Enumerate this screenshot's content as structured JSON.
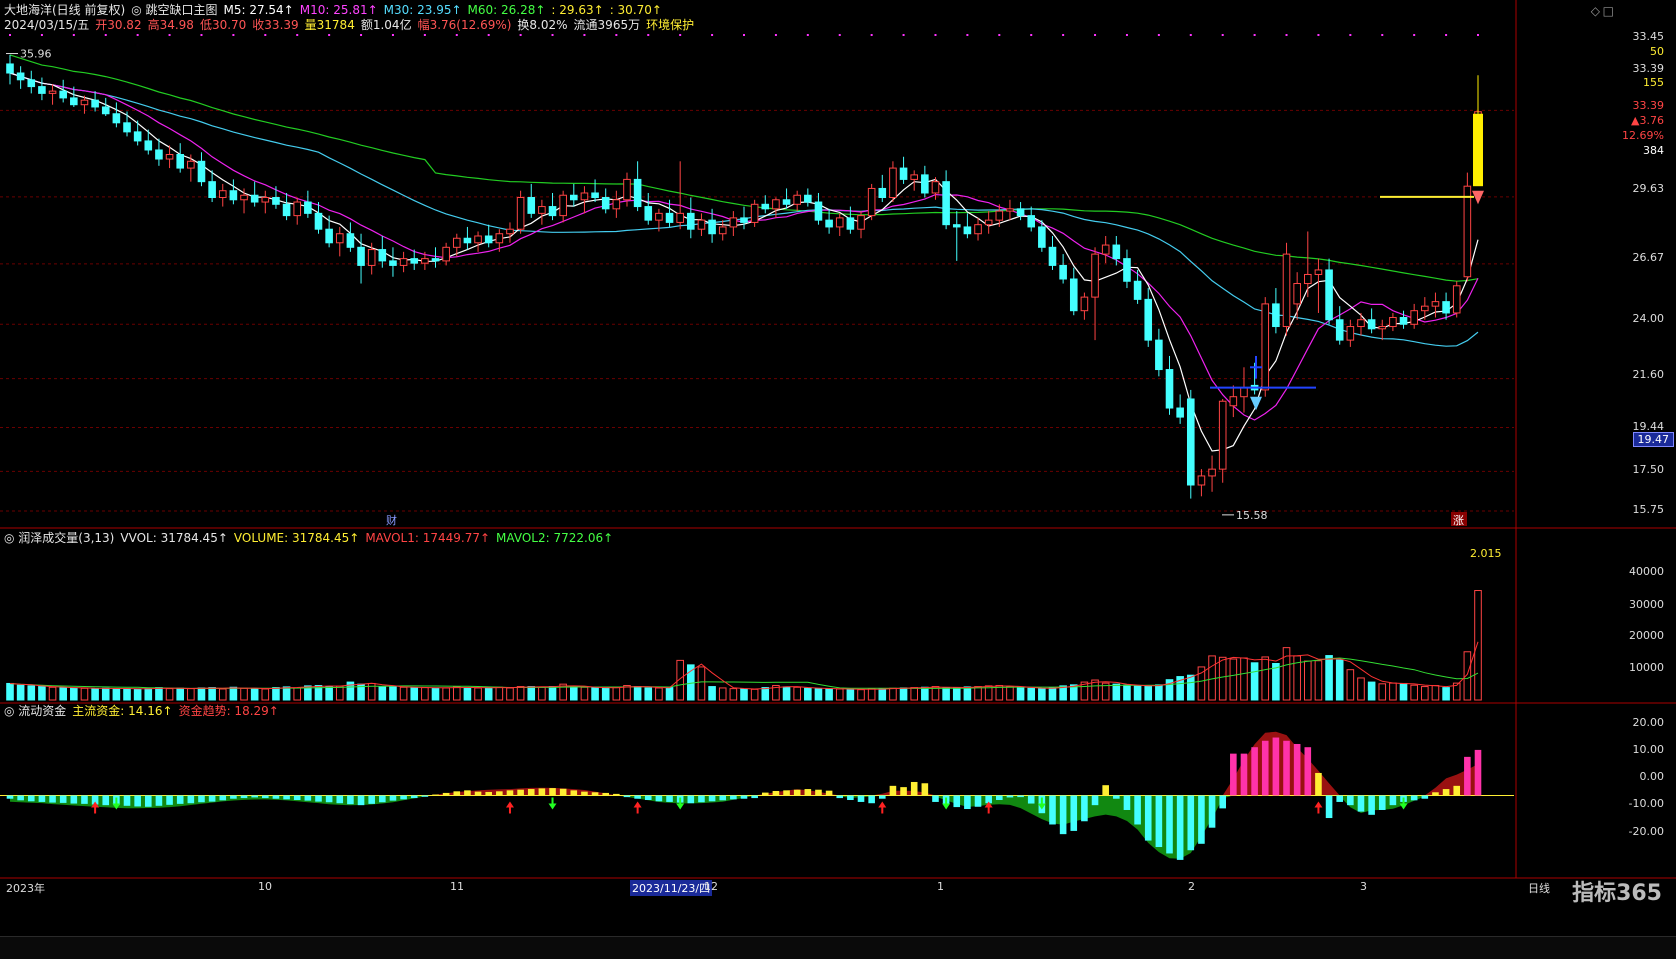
{
  "main": {
    "info1": [
      {
        "text": "大地海洋(日线 前复权)",
        "color": "#e6e6e6"
      },
      {
        "text": "◎ 跳空缺口主图",
        "color": "#e6e6e6"
      },
      {
        "text": "M5: 27.54↑",
        "color": "#ffffff"
      },
      {
        "text": "M10: 25.81↑",
        "color": "#ff44ff"
      },
      {
        "text": "M30: 23.95↑",
        "color": "#55ddff"
      },
      {
        "text": "M60: 26.28↑",
        "color": "#44ff44"
      },
      {
        "text": ": 29.63↑",
        "color": "#ffee33"
      },
      {
        "text": ": 30.70↑",
        "color": "#ffee33"
      }
    ],
    "info2": [
      {
        "text": "2024/03/15/五",
        "color": "#e6e6e6"
      },
      {
        "text": "开30.82",
        "color": "#ff5555"
      },
      {
        "text": "高34.98",
        "color": "#ff5555"
      },
      {
        "text": "低30.70",
        "color": "#ff5555"
      },
      {
        "text": "收33.39",
        "color": "#ff5555"
      },
      {
        "text": "量31784",
        "color": "#ffee33"
      },
      {
        "text": "额1.04亿",
        "color": "#e6e6e6"
      },
      {
        "text": "幅3.76(12.69%)",
        "color": "#ff5555"
      },
      {
        "text": "换8.02%",
        "color": "#e6e6e6"
      },
      {
        "text": "流通3965万",
        "color": "#e6e6e6"
      },
      {
        "text": "环境保护",
        "color": "#ffee33"
      }
    ],
    "price_axis": [
      "33.45",
      "50",
      "33.39",
      "155",
      "33.39",
      "▲3.76",
      "12.69%",
      "384",
      "29.63",
      "26.67",
      "24.00",
      "21.60",
      "19.44",
      "17.50",
      "15.75"
    ],
    "current_price": "19.47",
    "high_label": "35.96",
    "low_label": "15.58",
    "cai_marker": "财",
    "zhang_marker": "涨"
  },
  "volume": {
    "title": [
      {
        "text": "◎ 润泽成交量(3,13)",
        "color": "#e6e6e6"
      },
      {
        "text": "VVOL: 31784.45↑",
        "color": "#e6e6e6"
      },
      {
        "text": "VOLUME: 31784.45↑",
        "color": "#ffee33"
      },
      {
        "text": "MAVOL1: 17449.77↑",
        "color": "#ff4444"
      },
      {
        "text": "MAVOL2: 7722.06↑",
        "color": "#44ff44"
      }
    ],
    "axis": [
      "40000",
      "30000",
      "20000",
      "10000"
    ],
    "ratio": "2.015"
  },
  "fund": {
    "title": [
      {
        "text": "◎ 流动资金",
        "color": "#e6e6e6"
      },
      {
        "text": "主流资金: 14.16↑",
        "color": "#ffee33"
      },
      {
        "text": "资金趋势: 18.29↑",
        "color": "#ff4444"
      }
    ],
    "axis": [
      "20.00",
      "10.00",
      "0.00",
      "-10.00",
      "-20.00"
    ]
  },
  "x_axis": {
    "labels": [
      "2023年",
      "10",
      "11",
      "2023/11/23/四",
      "12",
      "1",
      "2",
      "3"
    ],
    "period": "日线"
  },
  "watermark": "指标365",
  "chart_data": [
    {
      "type": "candlestick",
      "title": "大地海洋(日线 前复权)",
      "last": {
        "date": "2024/03/15",
        "open": 30.82,
        "high": 34.98,
        "low": 30.7,
        "close": 33.39
      },
      "price_range": [
        15.0,
        37.0
      ],
      "ma": {
        "M5": 27.54,
        "M10": 25.81,
        "M30": 23.95,
        "M60": 26.28
      },
      "gap_lines": [
        29.63,
        30.7
      ],
      "high": 35.96,
      "low": 15.58,
      "candles": [
        [
          35.5,
          35.9,
          34.6,
          35.1
        ],
        [
          35.1,
          35.4,
          34.4,
          34.8
        ],
        [
          34.8,
          35.2,
          34.2,
          34.5
        ],
        [
          34.5,
          34.9,
          33.9,
          34.2
        ],
        [
          34.2,
          34.6,
          33.7,
          34.3
        ],
        [
          34.3,
          34.8,
          33.8,
          34.0
        ],
        [
          34.0,
          34.5,
          33.6,
          33.7
        ],
        [
          33.7,
          34.1,
          33.3,
          33.9
        ],
        [
          33.9,
          34.3,
          33.4,
          33.6
        ],
        [
          33.6,
          34.0,
          33.2,
          33.3
        ],
        [
          33.3,
          33.8,
          32.7,
          32.9
        ],
        [
          32.9,
          33.4,
          32.3,
          32.5
        ],
        [
          32.5,
          33.0,
          31.9,
          32.1
        ],
        [
          32.1,
          32.6,
          31.5,
          31.7
        ],
        [
          31.7,
          32.2,
          31.0,
          31.3
        ],
        [
          31.3,
          31.9,
          30.9,
          31.5
        ],
        [
          31.5,
          32.0,
          30.7,
          30.9
        ],
        [
          30.9,
          31.5,
          30.3,
          31.2
        ],
        [
          31.2,
          31.6,
          30.1,
          30.3
        ],
        [
          30.3,
          30.8,
          29.4,
          29.6
        ],
        [
          29.6,
          30.2,
          29.2,
          29.9
        ],
        [
          29.9,
          30.4,
          29.3,
          29.5
        ],
        [
          29.5,
          30.0,
          28.9,
          29.7
        ],
        [
          29.7,
          30.3,
          29.2,
          29.4
        ],
        [
          29.4,
          29.9,
          28.9,
          29.6
        ],
        [
          29.6,
          30.1,
          29.1,
          29.3
        ],
        [
          29.3,
          29.8,
          28.6,
          28.8
        ],
        [
          28.8,
          29.6,
          28.4,
          29.4
        ],
        [
          29.4,
          29.9,
          28.7,
          28.9
        ],
        [
          28.9,
          29.4,
          28.0,
          28.2
        ],
        [
          28.2,
          28.8,
          27.4,
          27.6
        ],
        [
          27.6,
          28.3,
          27.0,
          28.0
        ],
        [
          28.0,
          28.5,
          27.2,
          27.4
        ],
        [
          27.4,
          28.0,
          25.8,
          26.6
        ],
        [
          26.6,
          27.6,
          26.2,
          27.3
        ],
        [
          27.3,
          27.9,
          26.5,
          26.8
        ],
        [
          26.8,
          27.4,
          26.1,
          26.6
        ],
        [
          26.6,
          27.2,
          26.3,
          26.9
        ],
        [
          26.9,
          27.3,
          26.4,
          26.7
        ],
        [
          26.7,
          27.2,
          26.4,
          26.9
        ],
        [
          26.9,
          27.4,
          26.5,
          26.8
        ],
        [
          26.8,
          27.6,
          26.6,
          27.4
        ],
        [
          27.4,
          28.0,
          27.0,
          27.8
        ],
        [
          27.8,
          28.3,
          27.3,
          27.6
        ],
        [
          27.6,
          28.1,
          27.2,
          27.9
        ],
        [
          27.9,
          28.4,
          27.4,
          27.6
        ],
        [
          27.6,
          28.2,
          27.2,
          28.0
        ],
        [
          28.0,
          28.5,
          27.6,
          28.2
        ],
        [
          28.2,
          29.9,
          28.0,
          29.6
        ],
        [
          29.6,
          30.2,
          28.7,
          28.9
        ],
        [
          28.9,
          29.5,
          28.4,
          29.2
        ],
        [
          29.2,
          29.8,
          28.6,
          28.8
        ],
        [
          28.8,
          29.9,
          28.5,
          29.7
        ],
        [
          29.7,
          30.2,
          29.2,
          29.5
        ],
        [
          29.5,
          30.1,
          28.9,
          29.8
        ],
        [
          29.8,
          30.4,
          29.4,
          29.6
        ],
        [
          29.6,
          30.0,
          28.9,
          29.1
        ],
        [
          29.1,
          29.9,
          28.7,
          29.5
        ],
        [
          29.5,
          30.7,
          29.2,
          30.4
        ],
        [
          30.4,
          31.2,
          29.0,
          29.2
        ],
        [
          29.2,
          29.8,
          28.4,
          28.6
        ],
        [
          28.6,
          29.1,
          28.1,
          28.9
        ],
        [
          28.9,
          29.5,
          28.3,
          28.5
        ],
        [
          28.5,
          31.2,
          28.2,
          28.9
        ],
        [
          28.9,
          29.6,
          27.8,
          28.2
        ],
        [
          28.2,
          28.9,
          27.9,
          28.6
        ],
        [
          28.6,
          29.1,
          27.6,
          28.0
        ],
        [
          28.0,
          28.6,
          27.7,
          28.3
        ],
        [
          28.3,
          29.0,
          27.9,
          28.7
        ],
        [
          28.7,
          29.2,
          28.2,
          28.5
        ],
        [
          28.5,
          29.5,
          28.3,
          29.3
        ],
        [
          29.3,
          29.7,
          28.9,
          29.1
        ],
        [
          29.1,
          29.6,
          28.7,
          29.5
        ],
        [
          29.5,
          30.0,
          29.1,
          29.3
        ],
        [
          29.3,
          29.9,
          29.0,
          29.7
        ],
        [
          29.7,
          30.0,
          29.2,
          29.4
        ],
        [
          29.4,
          29.8,
          28.4,
          28.6
        ],
        [
          28.6,
          29.1,
          28.0,
          28.3
        ],
        [
          28.3,
          28.9,
          27.9,
          28.7
        ],
        [
          28.7,
          29.2,
          28.0,
          28.2
        ],
        [
          28.2,
          29.0,
          27.8,
          28.8
        ],
        [
          28.8,
          30.2,
          28.6,
          30.0
        ],
        [
          30.0,
          30.6,
          29.4,
          29.6
        ],
        [
          29.6,
          31.2,
          29.4,
          30.9
        ],
        [
          30.9,
          31.4,
          30.2,
          30.4
        ],
        [
          30.4,
          30.8,
          29.9,
          30.6
        ],
        [
          30.6,
          31.0,
          29.6,
          29.8
        ],
        [
          29.8,
          30.5,
          29.5,
          30.3
        ],
        [
          30.3,
          30.8,
          28.2,
          28.4
        ],
        [
          28.4,
          29.0,
          26.8,
          28.3
        ],
        [
          28.3,
          28.9,
          27.8,
          28.0
        ],
        [
          28.0,
          28.7,
          27.7,
          28.4
        ],
        [
          28.4,
          29.0,
          28.0,
          28.6
        ],
        [
          28.6,
          29.3,
          28.3,
          29.0
        ],
        [
          29.0,
          29.5,
          28.6,
          29.1
        ],
        [
          29.1,
          29.4,
          28.6,
          28.8
        ],
        [
          28.8,
          29.2,
          28.1,
          28.3
        ],
        [
          28.3,
          28.6,
          27.2,
          27.4
        ],
        [
          27.4,
          27.9,
          26.4,
          26.6
        ],
        [
          26.6,
          27.1,
          25.8,
          26.0
        ],
        [
          26.0,
          26.5,
          24.4,
          24.6
        ],
        [
          24.6,
          25.4,
          24.2,
          25.2
        ],
        [
          25.2,
          27.4,
          23.3,
          27.1
        ],
        [
          27.1,
          27.9,
          26.7,
          27.5
        ],
        [
          27.5,
          27.9,
          26.6,
          26.9
        ],
        [
          26.9,
          27.3,
          25.6,
          25.9
        ],
        [
          25.9,
          26.4,
          24.9,
          25.1
        ],
        [
          25.1,
          25.6,
          23.0,
          23.3
        ],
        [
          23.3,
          23.8,
          21.7,
          22.0
        ],
        [
          22.0,
          22.6,
          20.0,
          20.3
        ],
        [
          20.3,
          20.9,
          19.6,
          19.9
        ],
        [
          20.7,
          21.1,
          16.3,
          16.9
        ],
        [
          16.9,
          17.6,
          16.4,
          17.3
        ],
        [
          17.3,
          18.2,
          16.6,
          17.6
        ],
        [
          17.6,
          20.7,
          17.0,
          20.6
        ],
        [
          20.4,
          21.3,
          19.9,
          20.8
        ],
        [
          20.8,
          22.1,
          20.1,
          21.2
        ],
        [
          21.3,
          22.3,
          20.9,
          21.1
        ],
        [
          21.1,
          25.2,
          20.8,
          24.9
        ],
        [
          24.9,
          25.6,
          23.6,
          23.9
        ],
        [
          23.9,
          27.6,
          23.5,
          27.1
        ],
        [
          24.9,
          26.3,
          24.2,
          25.8
        ],
        [
          25.8,
          28.1,
          25.2,
          26.2
        ],
        [
          26.2,
          26.9,
          24.5,
          26.4
        ],
        [
          26.4,
          26.9,
          24.0,
          24.2
        ],
        [
          24.2,
          24.8,
          23.1,
          23.3
        ],
        [
          23.3,
          24.2,
          23.0,
          23.9
        ],
        [
          23.9,
          24.5,
          23.5,
          24.2
        ],
        [
          24.2,
          24.7,
          23.6,
          23.8
        ],
        [
          23.8,
          24.2,
          23.3,
          23.9
        ],
        [
          23.9,
          24.5,
          23.7,
          24.3
        ],
        [
          24.3,
          24.6,
          23.8,
          24.0
        ],
        [
          24.0,
          24.9,
          23.8,
          24.6
        ],
        [
          24.6,
          25.2,
          24.2,
          24.8
        ],
        [
          24.8,
          25.4,
          24.3,
          25.0
        ],
        [
          25.0,
          25.4,
          24.2,
          24.5
        ],
        [
          24.5,
          25.9,
          24.3,
          25.7
        ],
        [
          26.1,
          30.7,
          25.9,
          30.1
        ],
        [
          30.82,
          34.98,
          30.7,
          33.39
        ]
      ]
    },
    {
      "type": "bar",
      "title": "润泽成交量(3,13)",
      "ylim": [
        0,
        45000
      ],
      "last": 31784.45,
      "mavol1": 17449.77,
      "mavol2": 7722.06,
      "values": [
        4800,
        4300,
        4100,
        3900,
        3700,
        3600,
        3500,
        3400,
        3300,
        3400,
        3300,
        3300,
        3200,
        3300,
        3600,
        3300,
        3400,
        3300,
        3500,
        3600,
        3200,
        3700,
        3400,
        3300,
        3200,
        3600,
        3800,
        3500,
        4100,
        4200,
        3900,
        4000,
        5200,
        4600,
        4800,
        3900,
        3800,
        3700,
        3600,
        3600,
        3500,
        3500,
        3800,
        3600,
        3500,
        3600,
        3700,
        3500,
        3900,
        3900,
        3700,
        3900,
        4600,
        3800,
        3700,
        3600,
        3500,
        3600,
        4200,
        3900,
        3500,
        3500,
        3600,
        11500,
        10200,
        9600,
        3900,
        3500,
        3300,
        3200,
        3100,
        3600,
        4200,
        3800,
        3700,
        3400,
        3300,
        3300,
        3200,
        3100,
        3000,
        3200,
        3300,
        3400,
        3500,
        3600,
        3700,
        3900,
        3500,
        3600,
        3800,
        3900,
        4100,
        4200,
        3900,
        3700,
        3400,
        3300,
        3500,
        4100,
        4400,
        5200,
        5800,
        4900,
        4600,
        4300,
        4100,
        4000,
        4400,
        5900,
        6800,
        7200,
        9600,
        12800,
        12400,
        11900,
        12200,
        10800,
        12500,
        10600,
        15200,
        12800,
        11300,
        11400,
        12900,
        11600,
        8800,
        6400,
        5200,
        4700,
        4900,
        4800,
        4300,
        3900,
        4200,
        3600,
        4900,
        14000,
        31784
      ]
    },
    {
      "type": "bar",
      "title": "流动资金",
      "ylim": [
        -25,
        25
      ],
      "main_fund": 14.16,
      "fund_trend": 18.29,
      "values": [
        -1,
        -1.5,
        -1.8,
        -2,
        -2.2,
        -2.3,
        -2.5,
        -2.6,
        -2.8,
        -3,
        -3,
        -3.2,
        -3.4,
        -3.5,
        -3.2,
        -2.9,
        -2.6,
        -2.4,
        -2.1,
        -1.9,
        -1.5,
        -1,
        -0.8,
        -0.6,
        -0.8,
        -1,
        -1.2,
        -1.4,
        -1.6,
        -1.9,
        -2.1,
        -2.4,
        -2.7,
        -3,
        -2.6,
        -2.1,
        -1.6,
        -1.2,
        -0.8,
        -0.4,
        0.3,
        0.8,
        1.3,
        1.6,
        1.2,
        1.1,
        1.3,
        1.6,
        1.8,
        2,
        2.2,
        2.3,
        2.1,
        1.6,
        1.2,
        1,
        0.8,
        0.5,
        -0.5,
        -1,
        -1.4,
        -1.8,
        -2,
        -2.2,
        -2.4,
        -2.1,
        -1.8,
        -1.5,
        -1.2,
        -1,
        -0.8,
        0.9,
        1.4,
        1.6,
        1.8,
        2,
        1.8,
        1.5,
        -0.8,
        -1.4,
        -2,
        -2.4,
        -1,
        3,
        2.6,
        4.2,
        3.8,
        -2,
        -2.8,
        -3.6,
        -4.2,
        -3.5,
        -2.4,
        -1.4,
        -0.6,
        -0.5,
        -2.5,
        -5.5,
        -9,
        -12,
        -11,
        -8,
        -3,
        3.2,
        -1,
        -4.5,
        -9,
        -14,
        -16,
        -18,
        -20,
        -17,
        -15,
        -10,
        -4,
        13,
        13,
        15,
        17,
        18,
        17,
        16,
        15,
        7,
        -7,
        -2,
        -3,
        -5,
        -6,
        -4.5,
        -3,
        -2,
        -1.5,
        -1,
        1,
        2,
        3,
        12,
        14.16
      ]
    }
  ]
}
